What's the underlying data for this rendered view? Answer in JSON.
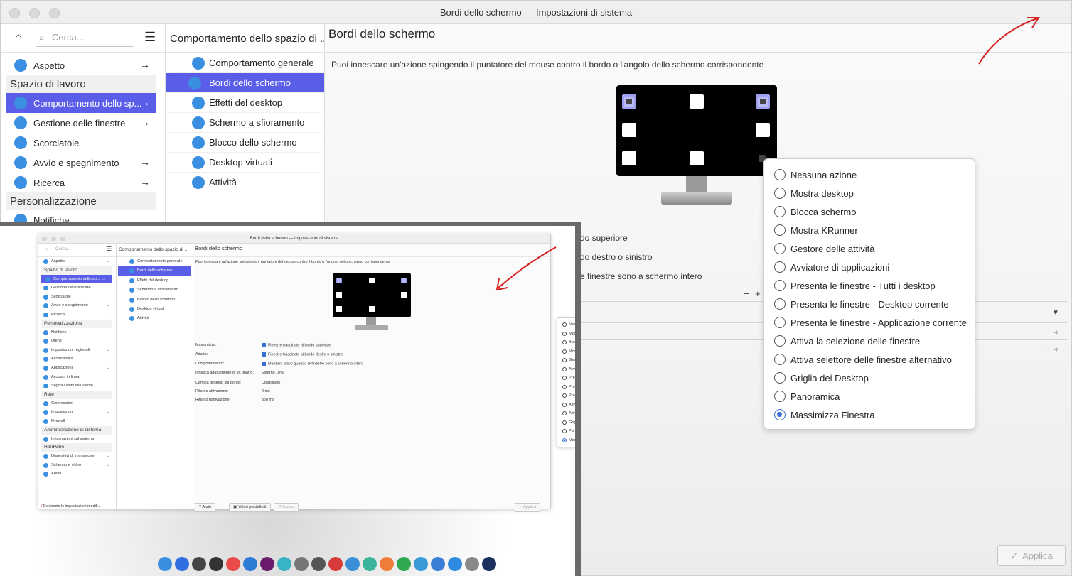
{
  "window": {
    "title": "Bordi dello schermo — Impostazioni di sistema"
  },
  "sidebar": {
    "search_placeholder": "Cerca...",
    "items": [
      {
        "label": "Aspetto",
        "icon": "palette-icon",
        "arrow": true
      },
      {
        "category": "Spazio di lavoro"
      },
      {
        "label": "Comportamento dello sp...",
        "icon": "workspace-icon",
        "arrow": true,
        "selected": true
      },
      {
        "label": "Gestione delle finestre",
        "icon": "windows-icon",
        "arrow": true
      },
      {
        "label": "Scorciatoie",
        "icon": "keyboard-icon",
        "arrow": false
      },
      {
        "label": "Avvio e spegnimento",
        "icon": "power-icon",
        "arrow": true
      },
      {
        "label": "Ricerca",
        "icon": "search-icon",
        "arrow": true
      },
      {
        "category": "Personalizzazione"
      },
      {
        "label": "Notifiche",
        "icon": "bell-icon",
        "arrow": false
      }
    ]
  },
  "middle": {
    "header": "Comportamento dello spazio di ...",
    "items": [
      {
        "label": "Comportamento generale",
        "icon": "general-icon"
      },
      {
        "label": "Bordi dello schermo",
        "icon": "screen-edges-icon",
        "selected": true
      },
      {
        "label": "Effetti del desktop",
        "icon": "effects-icon"
      },
      {
        "label": "Schermo a sfioramento",
        "icon": "touch-icon"
      },
      {
        "label": "Blocco dello schermo",
        "icon": "lock-icon"
      },
      {
        "label": "Desktop virtuali",
        "icon": "virtual-desktop-icon"
      },
      {
        "label": "Attività",
        "icon": "activities-icon"
      }
    ]
  },
  "main": {
    "title": "Bordi dello schermo",
    "description": "Puoi innescare un'azione spingendo il puntatore del mouse contro il bordo o l'angolo dello schermo corrispondente",
    "partial_rows": [
      "do superiore",
      "do destro o sinistro",
      "e finestre sono a schermo intero"
    ],
    "apply_label": "Applica"
  },
  "popup": {
    "options": [
      {
        "label": "Nessuna azione",
        "checked": false
      },
      {
        "label": "Mostra desktop",
        "checked": false
      },
      {
        "label": "Blocca schermo",
        "checked": false
      },
      {
        "label": "Mostra KRunner",
        "checked": false
      },
      {
        "label": "Gestore delle attività",
        "checked": false
      },
      {
        "label": "Avviatore di applicazioni",
        "checked": false
      },
      {
        "label": "Presenta le finestre - Tutti i desktop",
        "checked": false
      },
      {
        "label": "Presenta le finestre - Desktop corrente",
        "checked": false
      },
      {
        "label": "Presenta le finestre - Applicazione corrente",
        "checked": false
      },
      {
        "label": "Attiva la selezione delle finestre",
        "checked": false
      },
      {
        "label": "Attiva selettore delle finestre alternativo",
        "checked": false
      },
      {
        "label": "Griglia dei Desktop",
        "checked": false
      },
      {
        "label": "Panoramica",
        "checked": false
      },
      {
        "label": "Massimizza Finestra",
        "checked": true
      }
    ]
  },
  "inset": {
    "title": "Bordi dello schermo — Impostazioni di sistema",
    "search_placeholder": "Cerca...",
    "sidebar": [
      {
        "label": "Aspetto",
        "arrow": true
      },
      {
        "category": "Spazio di lavoro"
      },
      {
        "label": "Comportamento dello sp...",
        "arrow": true,
        "selected": true
      },
      {
        "label": "Gestione delle finestre",
        "arrow": true
      },
      {
        "label": "Scorciatoie",
        "arrow": false
      },
      {
        "label": "Avvio e spegnimento",
        "arrow": true
      },
      {
        "label": "Ricerca",
        "arrow": true
      },
      {
        "category": "Personalizzazione"
      },
      {
        "label": "Notifiche",
        "arrow": false
      },
      {
        "label": "Utenti",
        "arrow": false
      },
      {
        "label": "Impostazioni regionali",
        "arrow": true
      },
      {
        "label": "Accessibilità",
        "arrow": false
      },
      {
        "label": "Applicazioni",
        "arrow": true
      },
      {
        "label": "Account in linea",
        "arrow": false
      },
      {
        "label": "Segnalazioni dell'utente",
        "arrow": false
      },
      {
        "category": "Rete"
      },
      {
        "label": "Connessioni",
        "arrow": false
      },
      {
        "label": "Impostazioni",
        "arrow": true
      },
      {
        "label": "Firewall",
        "arrow": false
      },
      {
        "category": "Amministrazione di sistema"
      },
      {
        "label": "Informazioni sul sistema",
        "arrow": false
      },
      {
        "category": "Hardware"
      },
      {
        "label": "Dispositivi di immissione",
        "arrow": true
      },
      {
        "label": "Schermo e video",
        "arrow": true
      },
      {
        "label": "Audio",
        "arrow": false
      }
    ],
    "sidebar_footer": "Evidenzia le impostazioni modifi...",
    "middle_header": "Comportamento dello spazio di ...",
    "middle": [
      {
        "label": "Comportamento generale"
      },
      {
        "label": "Bordi dello schermo",
        "selected": true
      },
      {
        "label": "Effetti del desktop"
      },
      {
        "label": "Schermo a sfioramento"
      },
      {
        "label": "Blocco dello schermo"
      },
      {
        "label": "Desktop virtuali"
      },
      {
        "label": "Attività"
      }
    ],
    "main_title": "Bordi dello schermo",
    "description": "Puoi innescare un'azione spingendo il puntatore del mouse contro il bordo o l'angolo dello schermo corrispondente",
    "rows": [
      {
        "label": "Massimizza:",
        "value": "Finestre trascinate al bordo superiore",
        "checkbox": true
      },
      {
        "label": "Adatta:",
        "value": "Finestre trascinate al bordo destro o sinistro",
        "checkbox": true
      },
      {
        "label": "Comportamento:",
        "value": "Mantieni attivo quando le finestre sono a schermo intero",
        "checkbox": true
      },
      {
        "label": "Innesca adattamento di un quarto:",
        "value": "Esterno 10%",
        "checkbox": false
      },
      {
        "label": "Cambia desktop sul bordo:",
        "value": "Disabilitato",
        "checkbox": false
      },
      {
        "label": "Ritardo attivazione:",
        "value": "0 ms",
        "checkbox": false
      },
      {
        "label": "Ritardo riattivazione:",
        "value": "350 ms",
        "checkbox": false
      }
    ],
    "popup": [
      {
        "label": "Nessuna azione",
        "checked": false
      },
      {
        "label": "Mostra desktop",
        "checked": false
      },
      {
        "label": "Blocca schermo",
        "checked": false
      },
      {
        "label": "Mostra KRunner",
        "checked": false
      },
      {
        "label": "Gestore delle attività",
        "checked": false
      },
      {
        "label": "Avviatore di applicazioni",
        "checked": false
      },
      {
        "label": "Presenta le finestre - Tutti i desktop",
        "checked": false
      },
      {
        "label": "Presenta le finestre - Desktop corrente",
        "checked": false
      },
      {
        "label": "Presenta le finestre - Applicazione corrente",
        "checked": false
      },
      {
        "label": "Attiva la selezione delle finestre",
        "checked": false
      },
      {
        "label": "Attiva selettore delle finestre alternativo",
        "checked": false
      },
      {
        "label": "Griglia dei Desktop",
        "checked": false
      },
      {
        "label": "Panoramica",
        "checked": false
      },
      {
        "label": "Massimizza Finestra",
        "checked": true
      }
    ],
    "buttons": {
      "help": "Aiuto",
      "defaults": "Valori predefiniti",
      "reset": "Azzera",
      "apply": "Applica"
    },
    "dock_colors": [
      "#3b8fe0",
      "#2f6fe0",
      "#444",
      "#333",
      "#e94b4b",
      "#2e7bd6",
      "#6b1b6b",
      "#39b4c7",
      "#777",
      "#555",
      "#d73a3a",
      "#3a8fd6",
      "#3bb39a",
      "#ee7d3a",
      "#2fa84f",
      "#3a9ad6",
      "#3a7fd6",
      "#2f8ae0",
      "#888",
      "#1b2f5e"
    ]
  },
  "colors": {
    "accent": "#5a5de8",
    "annotation_arrow": "#d62020",
    "radio_checked": "#3a6fd8"
  }
}
